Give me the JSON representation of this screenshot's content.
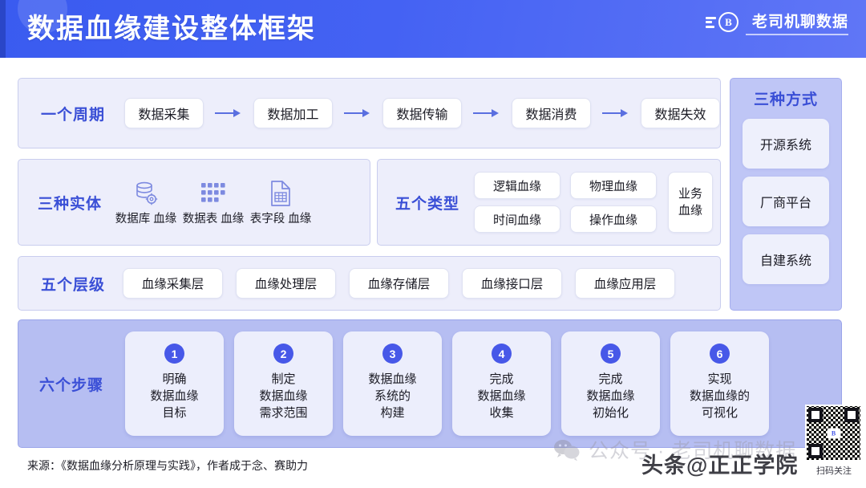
{
  "header": {
    "title": "数据血缘建设整体框架",
    "brand_text": "老司机聊数据",
    "brand_badge": "B"
  },
  "cycle": {
    "label": "一个周期",
    "steps": [
      "数据采集",
      "数据加工",
      "数据传输",
      "数据消费",
      "数据失效"
    ]
  },
  "entities": {
    "label": "三种实体",
    "items": [
      {
        "label": "数据库\n血缘",
        "icon": "database-gear-icon"
      },
      {
        "label": "数据表\n血缘",
        "icon": "table-grid-icon"
      },
      {
        "label": "表字段\n血缘",
        "icon": "document-table-icon"
      }
    ]
  },
  "types": {
    "label": "五个类型",
    "grid": [
      "逻辑血缘",
      "物理血缘",
      "时间血缘",
      "操作血缘"
    ],
    "tall": "业务\n血缘"
  },
  "levels": {
    "label": "五个层级",
    "items": [
      "血缘采集层",
      "血缘处理层",
      "血缘存储层",
      "血缘接口层",
      "血缘应用层"
    ]
  },
  "ways": {
    "label": "三种方式",
    "items": [
      "开源系统",
      "厂商平台",
      "自建系统"
    ]
  },
  "steps": {
    "label": "六个步骤",
    "items": [
      {
        "num": "1",
        "text": "明确\n数据血缘\n目标"
      },
      {
        "num": "2",
        "text": "制定\n数据血缘\n需求范围"
      },
      {
        "num": "3",
        "text": "数据血缘\n系统的\n构建"
      },
      {
        "num": "4",
        "text": "完成\n数据血缘\n收集"
      },
      {
        "num": "5",
        "text": "完成\n数据血缘\n初始化"
      },
      {
        "num": "6",
        "text": "实现\n数据血缘的\n可视化"
      }
    ]
  },
  "footer": {
    "source": "来源：《数据血缘分析原理与实践》，作者成于念、赛助力"
  },
  "watermarks": {
    "wechat": "公众号 · 老司机聊数据",
    "toutiao": "头条@正正学院",
    "qr_caption": "扫码关注"
  },
  "colors": {
    "header_blue": "#4462f3",
    "accent_blue": "#3a4fd6",
    "panel_bg": "#edeefb",
    "steps_bg": "#b6bef2",
    "ways_bg": "#bfc6f6",
    "step_num_bg": "#4758e8"
  }
}
